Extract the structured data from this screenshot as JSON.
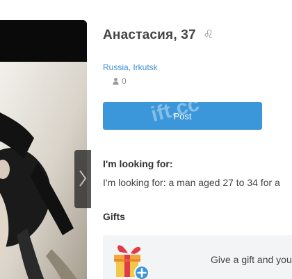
{
  "profile": {
    "name_age": "Анастасия, 37",
    "zodiac_icon": "leo-zodiac-icon",
    "zodiac_glyph": "♌︎",
    "location": "Russia, Irkutsk",
    "likes_count": "0",
    "likes_icon": "person-icon"
  },
  "actions": {
    "post_label": "Post"
  },
  "watermark": {
    "text": "ift.cc"
  },
  "looking_for": {
    "heading": "I'm looking for:",
    "text": "I'm looking for: a man aged 27 to 34 for a"
  },
  "gifts": {
    "heading": "Gifts",
    "prompt": "Give a gift and you",
    "icon": "gift-box-icon"
  },
  "photo": {
    "nav_icon": "chevron-right-icon"
  },
  "colors": {
    "accent": "#3b97d9",
    "link": "#3a8ed1",
    "gifts_bg": "#f3f4f6"
  }
}
